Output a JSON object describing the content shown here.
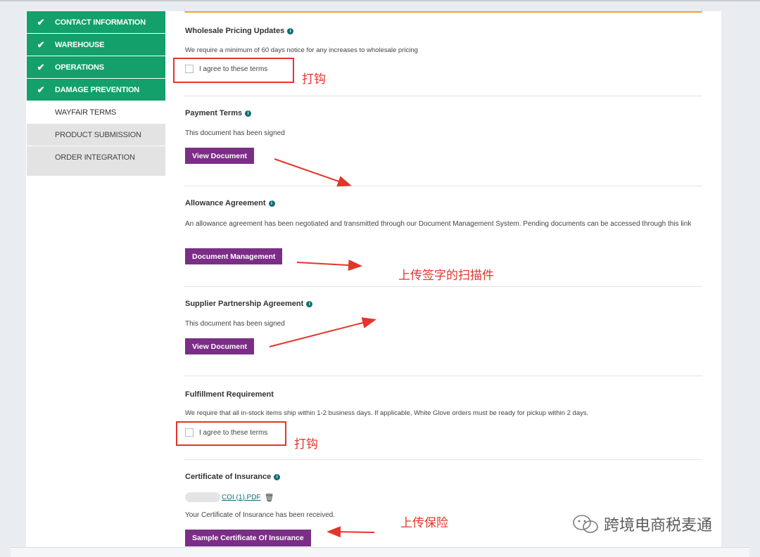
{
  "sidebar": {
    "items": [
      {
        "label": "CONTACT INFORMATION",
        "state": "done"
      },
      {
        "label": "WAREHOUSE",
        "state": "done"
      },
      {
        "label": "OPERATIONS",
        "state": "done"
      },
      {
        "label": "DAMAGE PREVENTION",
        "state": "done"
      },
      {
        "label": "WAYFAIR TERMS",
        "state": "current"
      },
      {
        "label": "PRODUCT SUBMISSION",
        "state": "todo"
      },
      {
        "label": "ORDER INTEGRATION",
        "state": "todo"
      }
    ],
    "done_color": "#13a06a"
  },
  "sections": {
    "wholesale": {
      "title": "Wholesale Pricing Updates",
      "text": "We require a minimum of 60 days notice for any increases to wholesale pricing",
      "agree_label": "I agree to these terms",
      "annotation": "打钩"
    },
    "payment": {
      "title": "Payment Terms",
      "text": "This document has been signed",
      "button": "View Document"
    },
    "allowance": {
      "title": "Allowance Agreement",
      "text": "An allowance agreement has been negotiated and transmitted through our Document Management System. Pending documents can be accessed through this link",
      "button": "Document Management",
      "annotation": "上传签字的扫描件"
    },
    "supplier": {
      "title": "Supplier Partnership Agreement",
      "text": "This document has been signed",
      "button": "View Document"
    },
    "fulfillment": {
      "title": "Fulfillment Requirement",
      "text": "We require that all in-stock items ship within 1-2 business days. If applicable, White Glove orders must be ready for pickup within 2 days.",
      "agree_label": "I agree to these terms",
      "annotation": "打钩"
    },
    "insurance": {
      "title": "Certificate of Insurance",
      "file_link": "COI (1).PDF",
      "text": "Your Certificate of Insurance has been received.",
      "button": "Sample Certificate Of Insurance",
      "annotation": "上传保险"
    }
  },
  "watermark": {
    "text": "跨境电商税麦通"
  },
  "colors": {
    "button": "#7b2e86",
    "annotation": "#e5342b",
    "accent_orange": "#e8a23a",
    "info_icon": "#0f6d6f"
  }
}
